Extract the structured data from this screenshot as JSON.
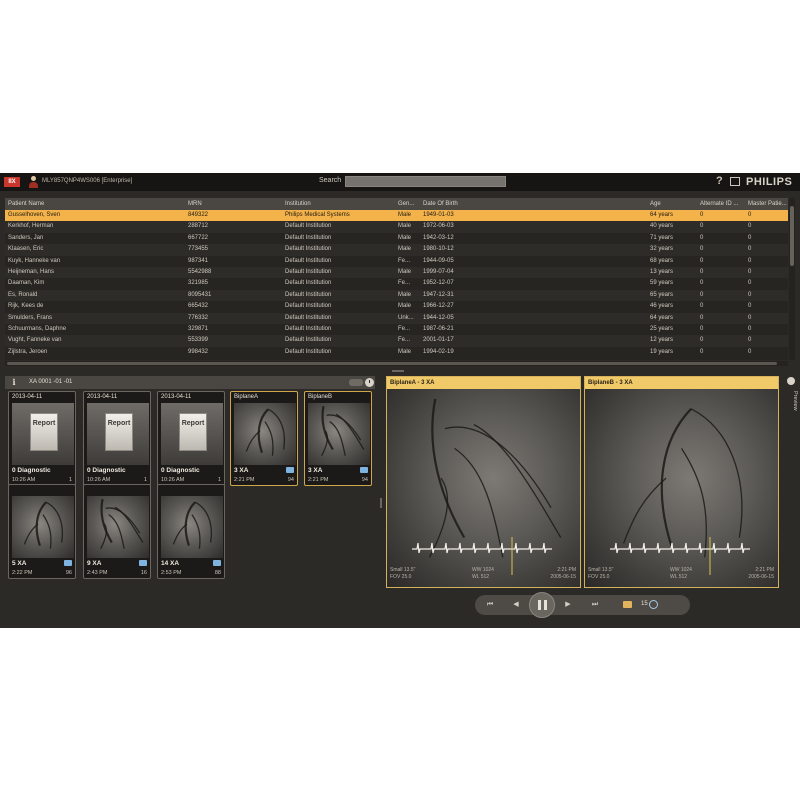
{
  "titlebar": {
    "app_badge": "IIX",
    "title": "MLY857QNP4WS006 [Enterprise]",
    "search_label": "Search",
    "help_icon": "?",
    "window_icon": "window-icon",
    "brand": "PHILIPS"
  },
  "table": {
    "columns": [
      "Patient Name",
      "MRN",
      "Institution",
      "Gen...",
      "Date Of Birth",
      "Age",
      "Alternate ID ...",
      "Master Patie..."
    ],
    "rows": [
      [
        "Gusselhoven, Sven",
        "849322",
        "Philips Medical Systems",
        "Male",
        "1949-01-03",
        "64 years",
        "0",
        "0"
      ],
      [
        "Kerkhof, Herman",
        "288712",
        "Default Institution",
        "Male",
        "1972-06-03",
        "40 years",
        "0",
        "0"
      ],
      [
        "Sanders, Jan",
        "667722",
        "Default Institution",
        "Male",
        "1942-03-12",
        "71 years",
        "0",
        "0"
      ],
      [
        "Klaasen, Eric",
        "773455",
        "Default Institution",
        "Male",
        "1980-10-12",
        "32 years",
        "0",
        "0"
      ],
      [
        "Kuyk, Hanneke van",
        "987341",
        "Default Institution",
        "Fe...",
        "1944-09-05",
        "68 years",
        "0",
        "0"
      ],
      [
        "Heijneman, Hans",
        "5542988",
        "Default Institution",
        "Male",
        "1999-07-04",
        "13 years",
        "0",
        "0"
      ],
      [
        "Daaman, Kim",
        "321985",
        "Default Institution",
        "Fe...",
        "1952-12-07",
        "59 years",
        "0",
        "0"
      ],
      [
        "Es, Ronald",
        "8095431",
        "Default Institution",
        "Male",
        "1947-12-31",
        "65 years",
        "0",
        "0"
      ],
      [
        "Rijk, Kees de",
        "665432",
        "Default Institution",
        "Male",
        "1966-12-27",
        "46 years",
        "0",
        "0"
      ],
      [
        "Smulders, Frans",
        "776332",
        "Default Institution",
        "Unk...",
        "1944-12-05",
        "64 years",
        "0",
        "0"
      ],
      [
        "Schuurmans, Daphne",
        "329871",
        "Default Institution",
        "Fe...",
        "1987-06-21",
        "25 years",
        "0",
        "0"
      ],
      [
        "Vught, Fanneke van",
        "553399",
        "Default Institution",
        "Fe...",
        "2001-01-17",
        "12 years",
        "0",
        "0"
      ],
      [
        "Zijlstra, Jeroen",
        "998432",
        "Default Institution",
        "Male",
        "1994-02-19",
        "19 years",
        "0",
        "0"
      ]
    ]
  },
  "study": {
    "info_icon": "i",
    "title": "XA 0001 -01 -01",
    "thumbs": [
      {
        "date": "2013-04-11",
        "kind": "report",
        "doc": "Report",
        "label": "0 Diagnostic",
        "time": "10:26 AM",
        "count": "1"
      },
      {
        "date": "2013-04-11",
        "kind": "report",
        "doc": "Report",
        "label": "0 Diagnostic",
        "time": "10:26 AM",
        "count": "1"
      },
      {
        "date": "2013-04-11",
        "kind": "report",
        "doc": "Report",
        "label": "0 Diagnostic",
        "time": "10:26 AM",
        "count": "1"
      },
      {
        "date": "BiplaneA",
        "kind": "angio",
        "label": "3 XA",
        "time": "2:21 PM",
        "count": "94"
      },
      {
        "date": "BiplaneB",
        "kind": "angio",
        "label": "3 XA",
        "time": "2:21 PM",
        "count": "94"
      },
      {
        "date": "",
        "kind": "angio",
        "label": "5 XA",
        "time": "2:22 PM",
        "count": "96"
      },
      {
        "date": "",
        "kind": "angio",
        "label": "9 XA",
        "time": "2:43 PM",
        "count": "16"
      },
      {
        "date": "",
        "kind": "angio",
        "label": "14 XA",
        "time": "2:53 PM",
        "count": "88"
      }
    ]
  },
  "viewers": [
    {
      "title": "BiplaneA - 3 XA",
      "ov_bl1": "Small 13.5\"",
      "ov_bl2": "FOV 25.0",
      "ov_bm1": "WW 1024",
      "ov_bm2": "WL 512",
      "ov_br1": "2:21 PM",
      "ov_br2": "2005-06-15"
    },
    {
      "title": "BiplaneB - 3 XA",
      "ov_bl1": "Small 13.5\"",
      "ov_bl2": "FOV 25.0",
      "ov_bm1": "WW 1024",
      "ov_bm2": "WL 512",
      "ov_br1": "2:21 PM",
      "ov_br2": "2005-06-15"
    }
  ],
  "controls": {
    "first": "⏮",
    "prev": "◀",
    "next": "▶",
    "last": "⏭",
    "fps": "15"
  },
  "side": {
    "label": "Preview"
  }
}
